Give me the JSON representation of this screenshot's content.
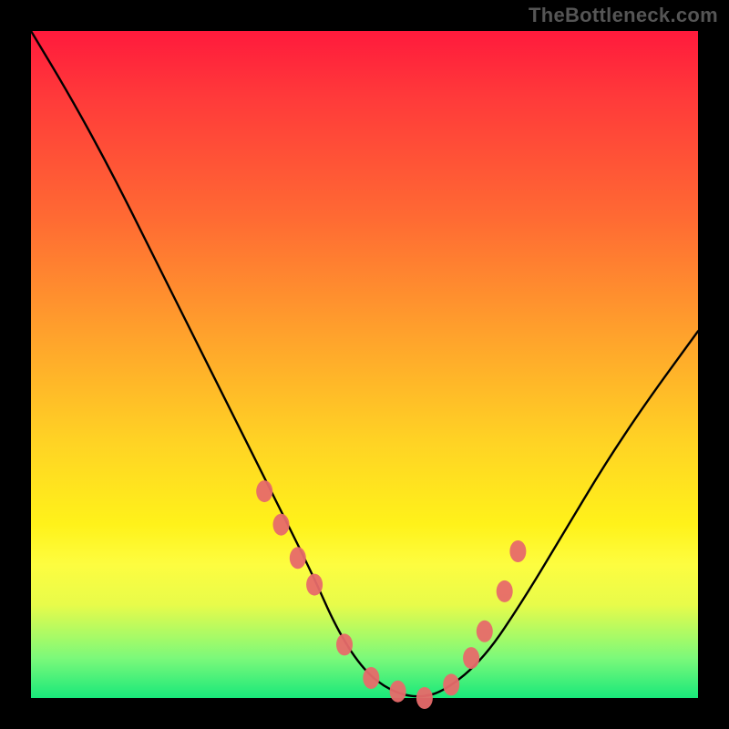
{
  "watermark": "TheBottleneck.com",
  "colors": {
    "background_frame": "#000000",
    "gradient_top": "#ff1a3c",
    "gradient_mid1": "#ffa02c",
    "gradient_mid2": "#fff21a",
    "gradient_bottom": "#18e87a",
    "curve": "#000000",
    "marker": "#e76a6a"
  },
  "chart_data": {
    "type": "line",
    "title": "",
    "xlabel": "",
    "ylabel": "",
    "xlim": [
      0,
      100
    ],
    "ylim": [
      0,
      100
    ],
    "grid": false,
    "legend": false,
    "series": [
      {
        "name": "bottleneck-curve",
        "x": [
          0,
          6,
          12,
          18,
          24,
          30,
          36,
          42,
          46,
          50,
          54,
          58,
          62,
          68,
          74,
          80,
          86,
          92,
          100
        ],
        "y": [
          100,
          90,
          79,
          67,
          55,
          43,
          31,
          19,
          10,
          4,
          1,
          0,
          1,
          6,
          15,
          25,
          35,
          44,
          55
        ]
      }
    ],
    "markers": {
      "name": "highlight-points",
      "x": [
        35,
        37.5,
        40,
        42.5,
        47,
        51,
        55,
        59,
        63,
        66,
        68,
        71,
        73
      ],
      "y": [
        31,
        26,
        21,
        17,
        8,
        3,
        1,
        0,
        2,
        6,
        10,
        16,
        22
      ]
    },
    "notes": "V-shaped bottleneck curve over a vertical red-to-green heat gradient. x and y are percentage-like (0-100); y=0 is at the bottom (best / green), y=100 at top (worst / red). Curve minimum near x≈58."
  }
}
